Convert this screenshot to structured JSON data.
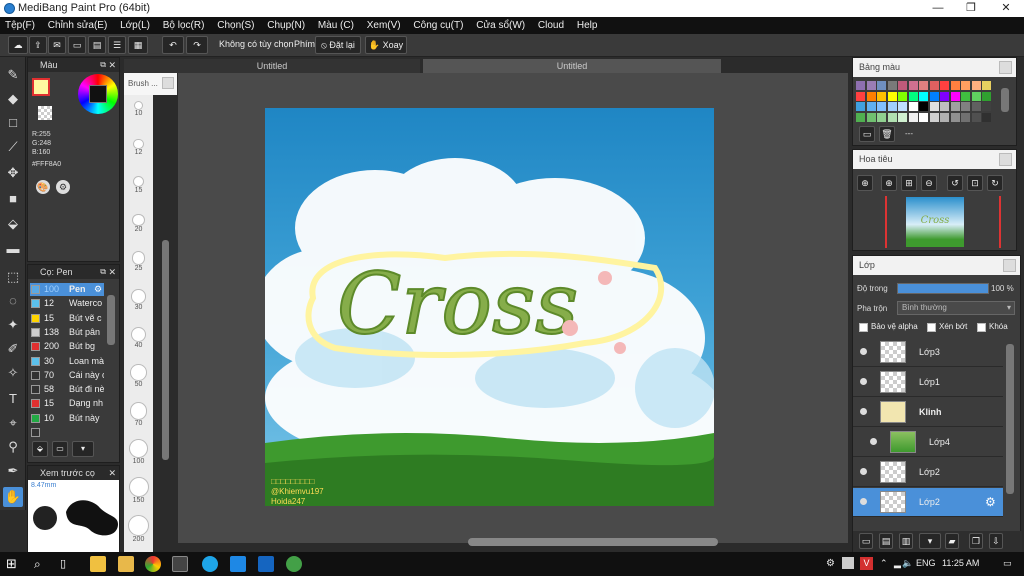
{
  "window": {
    "title": "MediBang Paint Pro (64bit)",
    "min": "—",
    "max": "❐",
    "close": "✕"
  },
  "menu": [
    "Tệp(F)",
    "Chỉnh sửa(E)",
    "Lớp(L)",
    "Bộ lọc(R)",
    "Chọn(S)",
    "Chụp(N)",
    "Màu (C)",
    "Xem(V)",
    "Công cụ(T)",
    "Cửa sổ(W)",
    "Cloud",
    "Help"
  ],
  "toolbar": {
    "no_option": "Không có tùy chọn",
    "key_label": "Phím",
    "reset": "⦸ Đặt lại",
    "rotate": "✋ Xoay"
  },
  "tabs": [
    "Untitled",
    "Untitled"
  ],
  "color_panel": {
    "title": "Màu",
    "r": "R:255",
    "g": "G:248",
    "b": "B:160",
    "hex": "#FFF8A0",
    "fg_color": "#FFF8A0",
    "bg_color": "#ffffff"
  },
  "brush_panel": {
    "title": "Cọ: Pen",
    "items": [
      {
        "size": "100",
        "name": "Pen",
        "color": "#5aa9e6",
        "selected": true
      },
      {
        "size": "12",
        "name": "Waterco",
        "color": "#5bc0eb"
      },
      {
        "size": "15",
        "name": "Bút vẽ c",
        "color": "#ffd400"
      },
      {
        "size": "138",
        "name": "Bút pân",
        "color": "#cccccc"
      },
      {
        "size": "200",
        "name": "Bút bg",
        "color": "#e03030"
      },
      {
        "size": "30",
        "name": "Loan mà",
        "color": "#5bc0eb"
      },
      {
        "size": "70",
        "name": "Cái này c",
        "color": "#333333"
      },
      {
        "size": "58",
        "name": "Bút đi nè",
        "color": "#333333"
      },
      {
        "size": "15",
        "name": "Dạng nh",
        "color": "#e03030"
      },
      {
        "size": "10",
        "name": "Bút này",
        "color": "#22aa44"
      },
      {
        "size": "",
        "name": "",
        "color": "#333333"
      }
    ]
  },
  "preview_panel": {
    "title": "Xem trước cọ",
    "size": "8.47mm"
  },
  "brush_sizes": [
    {
      "label": "10"
    },
    {
      "label": "12"
    },
    {
      "label": "15"
    },
    {
      "label": "20"
    },
    {
      "label": "25"
    },
    {
      "label": "30"
    },
    {
      "label": "40"
    },
    {
      "label": "50"
    },
    {
      "label": "70"
    },
    {
      "label": "100"
    },
    {
      "label": "150"
    },
    {
      "label": "200"
    }
  ],
  "brush_strip_title": "Brush ...",
  "artwork": {
    "text": "Cross",
    "credit1": "@Khiemvu197",
    "credit2": "Hoida247",
    "credit_tag": "□□□□□□□□□"
  },
  "palette": {
    "title": "Bảng màu",
    "extra": "---"
  },
  "navigator": {
    "title": "Hoa tiêu"
  },
  "layers": {
    "title": "Lớp",
    "opacity_label": "Độ trong",
    "opacity_value": "100 %",
    "opacity_level": 1.0,
    "blend_label": "Pha trộn",
    "blend_value": "Bình thường",
    "protect_alpha": "Bảo vệ alpha",
    "clip": "Xén bớt",
    "lock": "Khóa",
    "items": [
      {
        "name": "Lớp3"
      },
      {
        "name": "Lớp1"
      },
      {
        "name": "Klinh",
        "bold": true
      },
      {
        "name": "Lớp4"
      },
      {
        "name": "Lớp2"
      },
      {
        "name": "Lớp2",
        "selected": true
      }
    ]
  },
  "taskbar": {
    "lang": "ENG",
    "time": "11:25 AM"
  }
}
